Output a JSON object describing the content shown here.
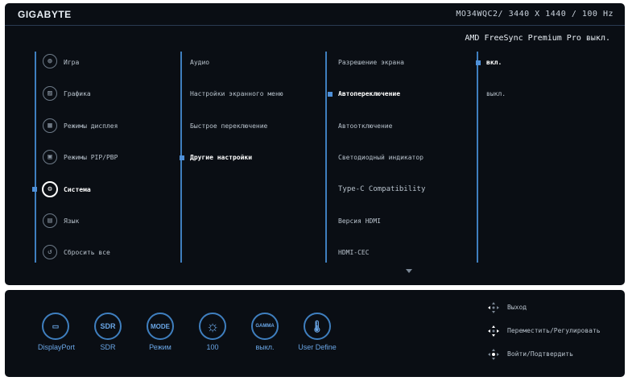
{
  "header": {
    "logo": "GIGABYTE",
    "model_info": "MO34WQC2/ 3440 X 1440 / 100 Hz",
    "status_line": "AMD FreeSync Premium Pro выкл."
  },
  "menu": {
    "level1": [
      {
        "label": "Игра",
        "icon": "gamepad-icon"
      },
      {
        "label": "Графика",
        "icon": "picture-icon"
      },
      {
        "label": "Режимы дисплея",
        "icon": "display-modes-icon"
      },
      {
        "label": "Режимы PIP/PBP",
        "icon": "pip-icon"
      },
      {
        "label": "Система",
        "icon": "gear-icon",
        "selected": true
      },
      {
        "label": "Язык",
        "icon": "floppy-icon"
      },
      {
        "label": "Сбросить все",
        "icon": "reset-icon"
      }
    ],
    "level2": [
      {
        "label": "Аудио"
      },
      {
        "label": "Настройки экранного меню"
      },
      {
        "label": "Быстрое переключение"
      },
      {
        "label": "Другие настройки",
        "selected": true
      }
    ],
    "level3": [
      {
        "label": "Разрешение экрана"
      },
      {
        "label": "Автопереключение",
        "selected": true
      },
      {
        "label": "Автоотключение"
      },
      {
        "label": "Светодиодный индикатор"
      },
      {
        "label": "Type-C Compatibility"
      },
      {
        "label": "Версия HDMI"
      },
      {
        "label": "HDMI-CEC"
      }
    ],
    "level4": [
      {
        "label": "вкл.",
        "selected": true
      },
      {
        "label": "выкл."
      }
    ]
  },
  "quick": [
    {
      "label": "DisplayPort",
      "icon": "displayport-icon",
      "glyph": "▭"
    },
    {
      "label": "SDR",
      "icon": "sdr-icon",
      "glyph": "SDR"
    },
    {
      "label": "Режим",
      "icon": "mode-icon",
      "glyph": "MODE"
    },
    {
      "label": "100",
      "icon": "brightness-icon",
      "glyph": "☼"
    },
    {
      "label": "выкл.",
      "icon": "gamma-icon",
      "glyph": "GAMMA"
    },
    {
      "label": "User Define",
      "icon": "thermometer-icon",
      "glyph": "🌡"
    }
  ],
  "nav": [
    {
      "label": "Выход",
      "icon": "joystick-left-icon"
    },
    {
      "label": "Переместить/Регулировать",
      "icon": "joystick-move-icon"
    },
    {
      "label": "Войти/Подтвердить",
      "icon": "joystick-press-icon"
    }
  ],
  "colors": {
    "accent": "#3f7fbf",
    "background": "#0a0e14",
    "selected_marker": "#4f90d8"
  }
}
